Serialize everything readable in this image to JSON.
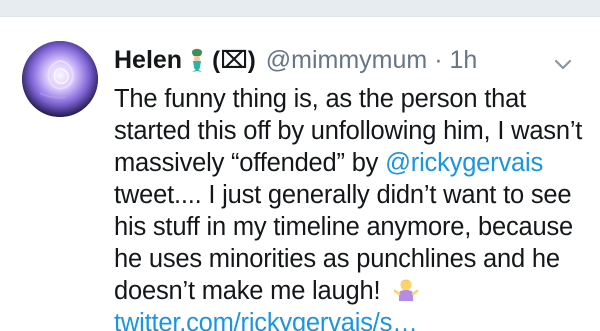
{
  "tweet": {
    "display_name": "Helen",
    "name_flag": "(⌧)",
    "handle": "@mimmymum",
    "separator": "·",
    "time": "1h",
    "lines": [
      {
        "pre": "The funny thing is, as the person that",
        "mention": "",
        "post": ""
      },
      {
        "pre": "started this off by unfollowing him, I wasn’t",
        "mention": "",
        "post": ""
      },
      {
        "pre": "massively “offended” by ",
        "mention": "@rickygervais",
        "post": ""
      },
      {
        "pre": " tweet.... I just generally didn’t want to see",
        "mention": "",
        "post": ""
      },
      {
        "pre": "his stuff in my timeline anymore, because",
        "mention": "",
        "post": ""
      },
      {
        "pre": "he uses minorities as punchlines and he",
        "mention": "",
        "post": ""
      },
      {
        "pre": "doesn’t make me laugh! ",
        "mention": "",
        "post": ""
      }
    ],
    "link_text": "twitter.com/rickygervais/s…",
    "icons": {
      "avatar": "rose-avatar",
      "name_emoji": "mermaid-icon",
      "text_emoji": "person-shrugging-icon",
      "menu": "chevron-down-icon"
    },
    "colors": {
      "link": "#1b95e0",
      "secondary_text": "#657786",
      "primary_text": "#14171a"
    }
  }
}
